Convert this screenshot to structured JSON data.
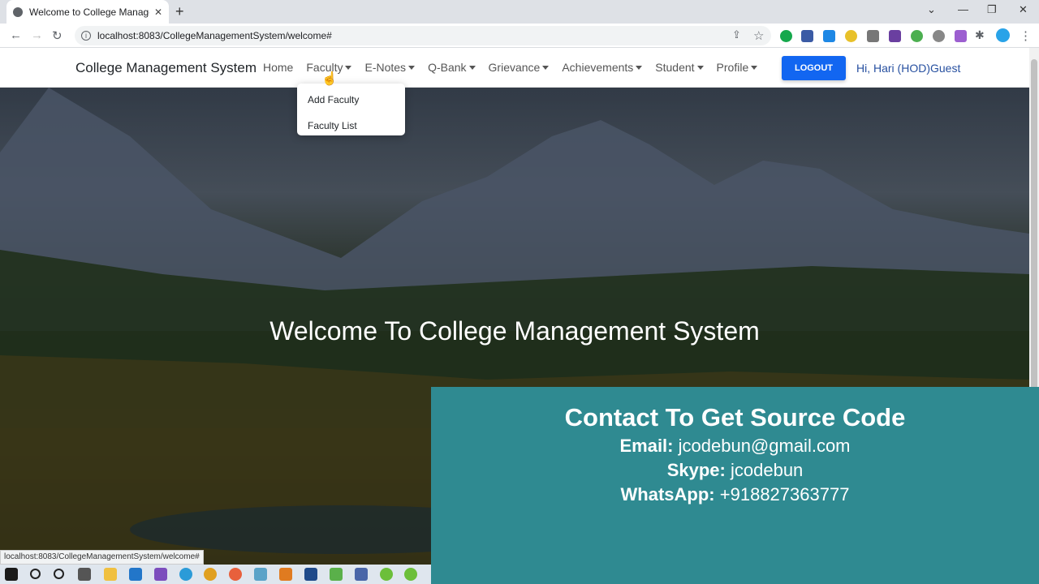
{
  "browser": {
    "tab_title": "Welcome to College Managemen",
    "url": "localhost:8083/CollegeManagementSystem/welcome#",
    "status_url": "localhost:8083/CollegeManagementSystem/welcome#"
  },
  "navbar": {
    "brand": "College Management System",
    "links": [
      "Home",
      "Faculty",
      "E-Notes",
      "Q-Bank",
      "Grievance",
      "Achievements",
      "Student",
      "Profile"
    ],
    "logout_label": "LOGOUT",
    "greeting": "Hi, Hari (HOD)Guest"
  },
  "faculty_dropdown": {
    "items": [
      "Add Faculty",
      "Faculty List"
    ]
  },
  "hero": {
    "title": "Welcome To College Management System"
  },
  "contact": {
    "heading": "Contact To Get Source Code",
    "email_label": "Email:",
    "email_value": "jcodebun@gmail.com",
    "skype_label": "Skype:",
    "skype_value": "jcodebun",
    "whatsapp_label": "WhatsApp:",
    "whatsapp_value": "+918827363777",
    "bg_color": "#2f8a91"
  },
  "colors": {
    "logout_button": "#1266f1",
    "greeting_text": "#2750a0"
  }
}
